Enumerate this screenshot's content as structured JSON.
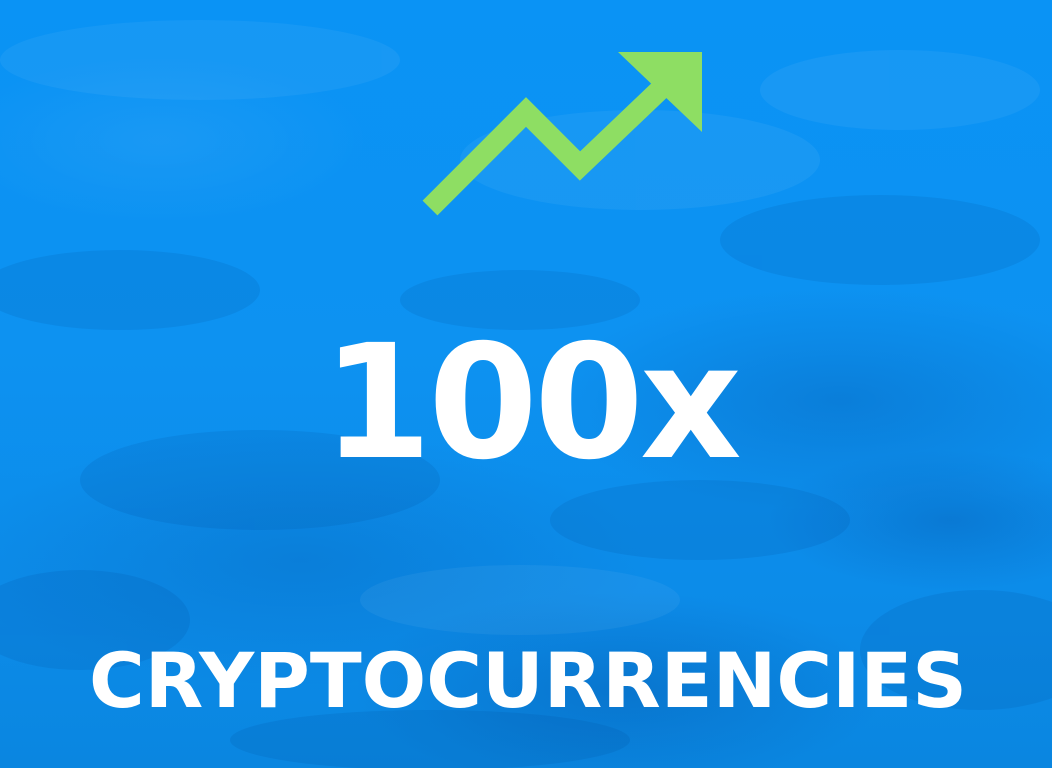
{
  "headline": "100x",
  "subline": "CRYPTOCURRENCIES",
  "icon": "trend-up-arrow-icon",
  "colors": {
    "background": "#0d92f1",
    "arrow": "#8ede63",
    "text": "#ffffff"
  }
}
